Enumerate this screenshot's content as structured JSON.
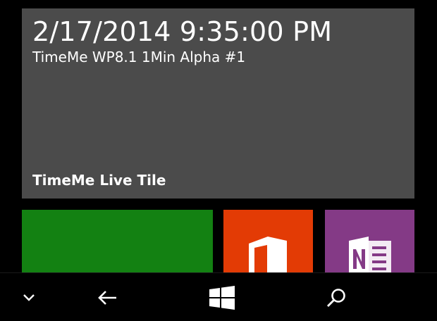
{
  "live_tile": {
    "datetime": "2/17/2014 9:35:00 PM",
    "subtitle": "TimeMe WP8.1 1Min Alpha #1",
    "name": "TimeMe Live Tile",
    "color": "#4b4b4b"
  },
  "tiles": [
    {
      "id": "green",
      "color": "#138112"
    },
    {
      "id": "office",
      "icon": "office-icon",
      "color": "#e33b05"
    },
    {
      "id": "onenote",
      "icon": "onenote-icon",
      "color": "#843a86"
    }
  ],
  "navbar": {
    "buttons": [
      {
        "id": "expand",
        "icon": "chevron-down-icon"
      },
      {
        "id": "back",
        "icon": "back-arrow-icon"
      },
      {
        "id": "start",
        "icon": "windows-logo-icon"
      },
      {
        "id": "search",
        "icon": "search-icon"
      }
    ]
  }
}
